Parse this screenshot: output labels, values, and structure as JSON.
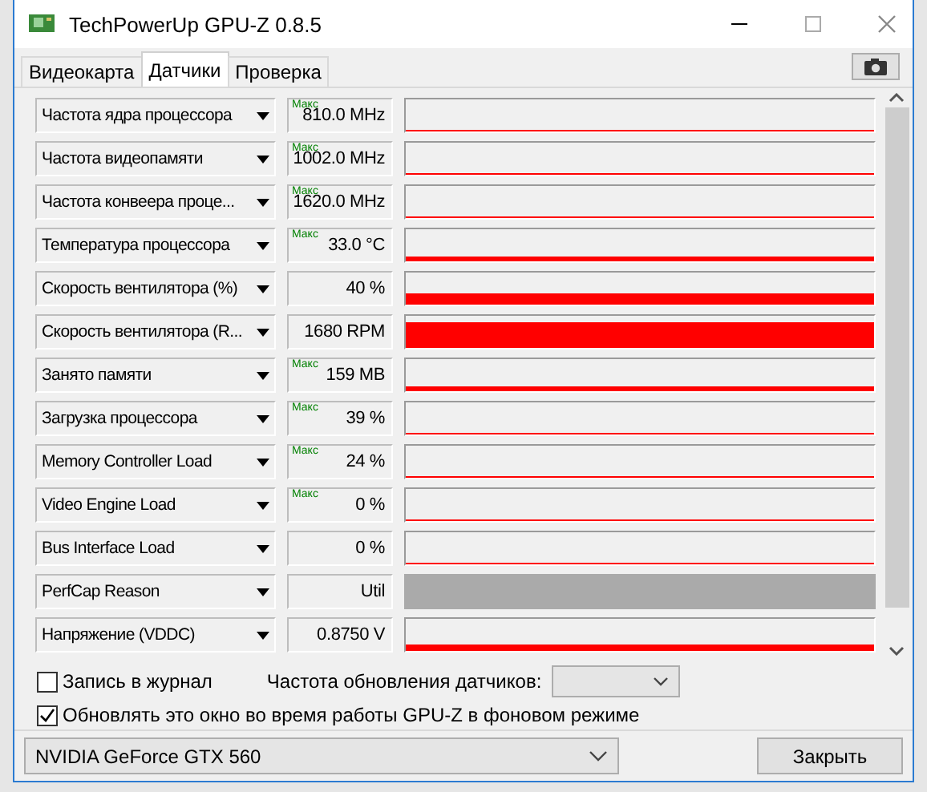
{
  "window": {
    "title": "TechPowerUp GPU-Z 0.8.5"
  },
  "tabs": [
    {
      "label": "Видеокарта",
      "selected": false
    },
    {
      "label": "Датчики",
      "selected": true
    },
    {
      "label": "Проверка",
      "selected": false
    }
  ],
  "sensors": [
    {
      "name": "Частота ядра процессора",
      "max_label": "Макс",
      "value": "810.0 MHz",
      "kind": "graph"
    },
    {
      "name": "Частота видеопамяти",
      "max_label": "Макс",
      "value": "1002.0 MHz",
      "kind": "graph"
    },
    {
      "name": "Частота конвеера проце...",
      "max_label": "Макс",
      "value": "1620.0 MHz",
      "kind": "graph"
    },
    {
      "name": "Температура процессора",
      "max_label": "Макс",
      "value": "33.0 °C",
      "kind": "graph"
    },
    {
      "name": "Скорость вентилятора (%)",
      "value": "40 %",
      "kind": "graph"
    },
    {
      "name": "Скорость вентилятора (R...",
      "value": "1680 RPM",
      "kind": "graph"
    },
    {
      "name": "Занято памяти",
      "max_label": "Макс",
      "value": "159 MB",
      "kind": "graph"
    },
    {
      "name": "Загрузка процессора",
      "max_label": "Макс",
      "value": "39 %",
      "kind": "graph"
    },
    {
      "name": "Memory Controller Load",
      "max_label": "Макс",
      "value": "24 %",
      "kind": "graph"
    },
    {
      "name": "Video Engine Load",
      "max_label": "Макс",
      "value": "0 %",
      "kind": "graph"
    },
    {
      "name": "Bus Interface Load",
      "value": "0 %",
      "kind": "graph"
    },
    {
      "name": "PerfCap Reason",
      "value": "Util",
      "kind": "state"
    },
    {
      "name": "Напряжение (VDDC)",
      "value": "0.8750 V",
      "kind": "graph"
    }
  ],
  "log_option": {
    "label": "Запись в журнал",
    "checked": false
  },
  "refresh": {
    "label": "Частота обновления датчиков:"
  },
  "background_option": {
    "label": "Обновлять это окно во время работы GPU-Z в фоновом режиме",
    "checked": true
  },
  "gpu_select": {
    "value": "NVIDIA GeForce GTX 560"
  },
  "close_button": "Закрыть"
}
